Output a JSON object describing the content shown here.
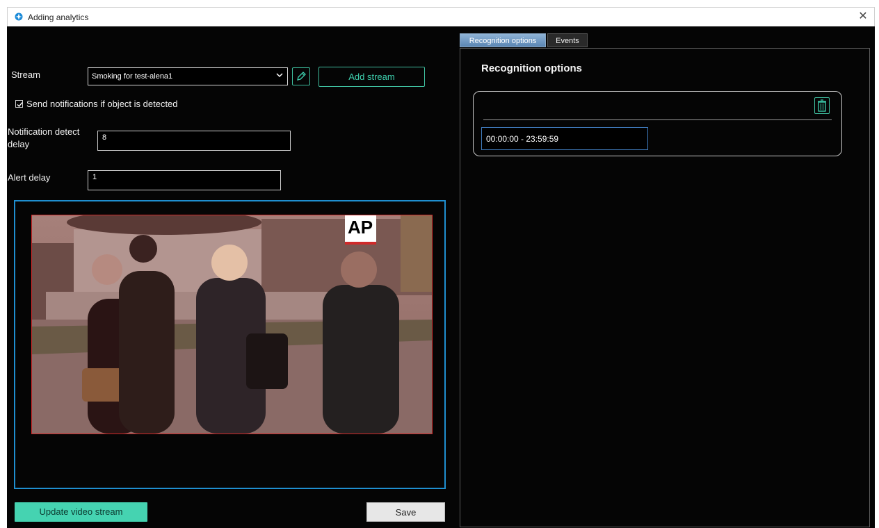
{
  "window": {
    "title": "Adding analytics",
    "close_icon": "close-icon",
    "app_icon": "app-logo-icon"
  },
  "left": {
    "stream_label": "Stream",
    "stream_value": "Smoking for test-alena1",
    "add_stream_label": "Add stream",
    "send_notifications_label": "Send notifications if object is detected",
    "send_notifications_checked": true,
    "notification_delay_label_1": "Notification detect",
    "notification_delay_label_2": "delay",
    "notification_delay_value": "8",
    "alert_delay_label": "Alert delay",
    "alert_delay_value": "1",
    "video_watermark": "AP",
    "update_button_label": "Update video stream",
    "save_button_label": "Save"
  },
  "right": {
    "tabs": [
      {
        "label": "Recognition options",
        "active": true
      },
      {
        "label": "Events",
        "active": false
      }
    ],
    "section_title": "Recognition options",
    "time_range_value": "00:00:00 - 23:59:59"
  },
  "colors": {
    "accent": "#45d3b1",
    "frame_blue": "#1f8fd0",
    "detection_red": "#d02a2a",
    "background": "#050505"
  }
}
